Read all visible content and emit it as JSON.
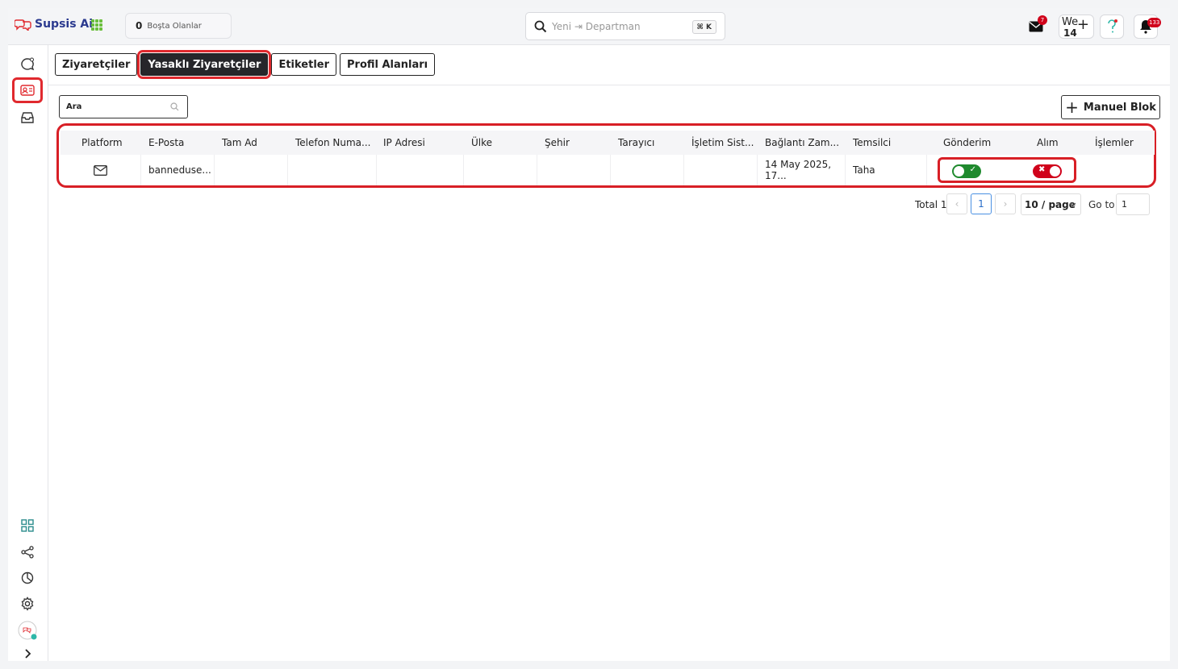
{
  "app": {
    "name": "Supsis Ai"
  },
  "header": {
    "idle_count": "0",
    "idle_label": "Boşta Olanlar",
    "search_placeholder": "Yeni ⇥ Departman",
    "search_shortcut": "⌘ K",
    "mail_badge": "7",
    "we_label": "We",
    "we_count": "14",
    "notification_badge": "133"
  },
  "tabs": [
    {
      "label": "Ziyaretçiler",
      "active": false
    },
    {
      "label": "Yasaklı Ziyaretçiler",
      "active": true
    },
    {
      "label": "Etiketler",
      "active": false
    },
    {
      "label": "Profil Alanları",
      "active": false
    }
  ],
  "table_search": {
    "placeholder": "Ara"
  },
  "manual_block_label": "Manuel Blok",
  "table": {
    "columns": [
      "Platform",
      "E-Posta",
      "Tam Ad",
      "Telefon Numa...",
      "IP Adresi",
      "Ülke",
      "Şehir",
      "Tarayıcı",
      "İşletim Sist...",
      "Bağlantı Zam...",
      "Temsilci",
      "Gönderim",
      "Alım",
      "İşlemler"
    ],
    "rows": [
      {
        "platform_icon": "mail-icon",
        "email": "banneduse...",
        "full_name": "",
        "phone": "",
        "ip": "",
        "country": "",
        "city": "",
        "browser": "",
        "os": "",
        "connection_time": "14 May 2025, 17...",
        "agent": "Taha",
        "send_enabled": true,
        "receive_enabled": false
      }
    ]
  },
  "pagination": {
    "total_label": "Total 1",
    "current_page": "1",
    "page_size": "10 / page",
    "goto_label": "Go to",
    "goto_value": "1"
  },
  "colors": {
    "accent_red": "#d81f26",
    "toggle_on": "#1f8a2e",
    "toggle_off": "#d0021b",
    "brand": "#2b3a8f"
  }
}
